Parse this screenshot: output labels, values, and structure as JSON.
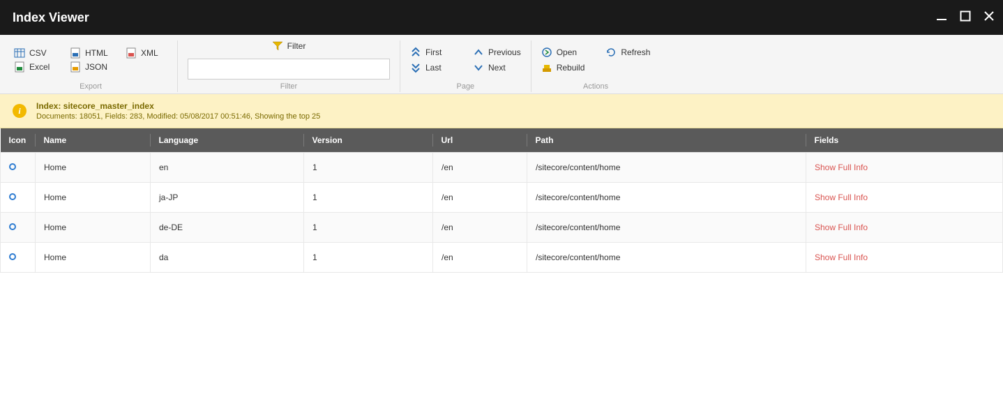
{
  "window": {
    "title": "Index Viewer"
  },
  "toolbar": {
    "export": {
      "csv": "CSV",
      "html": "HTML",
      "xml": "XML",
      "excel": "Excel",
      "json": "JSON",
      "group_label": "Export"
    },
    "filter": {
      "label": "Filter",
      "value": "",
      "group_label": "Filter"
    },
    "page": {
      "first": "First",
      "previous": "Previous",
      "last": "Last",
      "next": "Next",
      "group_label": "Page"
    },
    "actions": {
      "open": "Open",
      "refresh": "Refresh",
      "rebuild": "Rebuild",
      "group_label": "Actions"
    }
  },
  "info": {
    "title": "Index: sitecore_master_index",
    "subtitle": "Documents: 18051, Fields: 283, Modified: 05/08/2017 00:51:46, Showing the top 25"
  },
  "table": {
    "headers": {
      "icon": "Icon",
      "name": "Name",
      "language": "Language",
      "version": "Version",
      "url": "Url",
      "path": "Path",
      "fields": "Fields"
    },
    "rows": [
      {
        "name": "Home",
        "language": "en",
        "version": "1",
        "url": "/en",
        "path": "/sitecore/content/home",
        "fields_link": "Show Full Info"
      },
      {
        "name": "Home",
        "language": "ja-JP",
        "version": "1",
        "url": "/en",
        "path": "/sitecore/content/home",
        "fields_link": "Show Full Info"
      },
      {
        "name": "Home",
        "language": "de-DE",
        "version": "1",
        "url": "/en",
        "path": "/sitecore/content/home",
        "fields_link": "Show Full Info"
      },
      {
        "name": "Home",
        "language": "da",
        "version": "1",
        "url": "/en",
        "path": "/sitecore/content/home",
        "fields_link": "Show Full Info"
      }
    ]
  },
  "colors": {
    "accent_red": "#d9534f",
    "banner_bg": "#fdf2c5",
    "header_dark": "#1a1a1a",
    "table_header": "#5a5a5a"
  }
}
